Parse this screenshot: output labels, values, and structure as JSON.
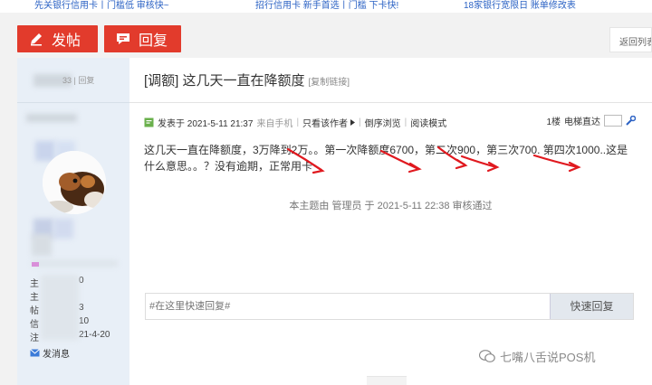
{
  "top_links": [
    "先关银行信用卡丨门槛低 审核快~",
    "招行信用卡 新手首选丨门槛 下卡快!",
    "18家银行宽限日 账单修改表"
  ],
  "actions": {
    "post_label": "发帖",
    "reply_label": "回复",
    "back_list_label": "返回列表"
  },
  "sidebar": {
    "head_fragment": "33 | 回复",
    "stats": [
      {
        "key": "主",
        "val": "0"
      },
      {
        "key": "主",
        "val": ""
      },
      {
        "key": "帖",
        "val": "3"
      },
      {
        "key": "信",
        "val": "10"
      },
      {
        "key": "注",
        "val": "21-4-20"
      }
    ],
    "send_message_label": "发消息"
  },
  "post": {
    "title": "[调额] 这几天一直在降额度",
    "copy_link_label": "[复制链接]",
    "posted_label": "发表于 2021-5-11 21:37",
    "source_label": "来自手机",
    "only_author_label": "只看该作者",
    "reverse_label": "倒序浏览",
    "read_mode_label": "阅读模式",
    "floor_label": "1楼",
    "elevator_label": "电梯直达",
    "content": "这几天一直在降额度，3万降到2万。。第一次降额度6700，第二次900，第三次700. 第四次1000..这是什么意思。。？没有逾期，正常用卡",
    "audit_text": "本主题由 管理员 于 2021-5-11 22:38 审核通过"
  },
  "quick_reply": {
    "placeholder": "#在这里快速回复#",
    "button_label": "快速回复"
  },
  "watermark": "七嘴八舌说POS机",
  "colors": {
    "accent_red": "#e23b2c",
    "link_blue": "#2b62c4",
    "sidebar_bg": "#e8eff7"
  }
}
